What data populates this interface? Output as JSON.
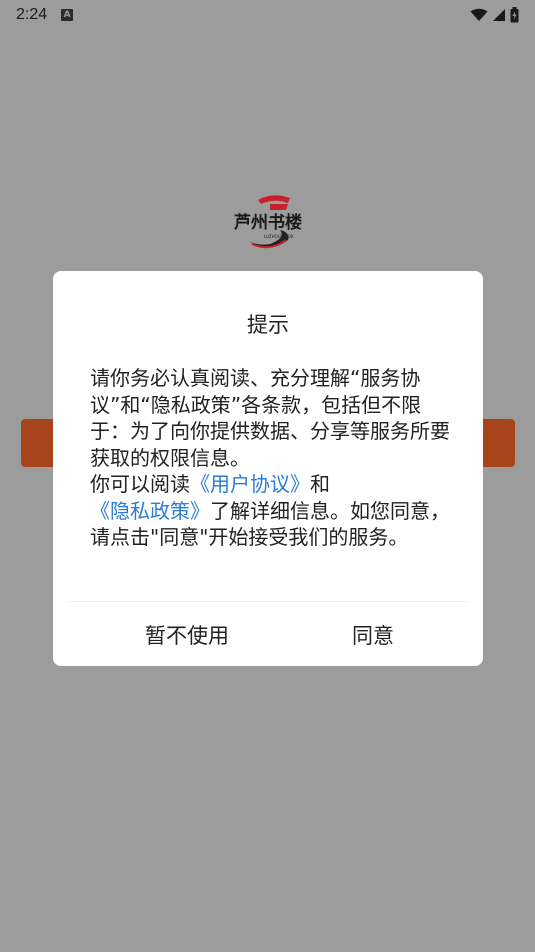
{
  "status_bar": {
    "time": "2:24",
    "app_icon_letter": "A",
    "icons": [
      "wifi-icon",
      "signal-icon",
      "battery-icon"
    ]
  },
  "logo": {
    "text": "芦州书楼",
    "subtext": "LUZHOU BOOK"
  },
  "dialog": {
    "title": "提示",
    "body_intro": "请你务必认真阅读、充分理解“服务协议”和“隐私政策”各条款，包括但不限于：为了向你提供数据、分享等服务所要获取的权限信息。",
    "read_prefix": "你可以阅读",
    "user_agreement_link": "《用户协议》",
    "and_text": "和",
    "privacy_policy_link": "《隐私政策》",
    "body_outro": "了解详细信息。如您同意，请点击\"同意\"开始接受我们的服务。",
    "decline_label": "暂不使用",
    "agree_label": "同意"
  },
  "colors": {
    "overlay": "#9c9c9c",
    "accent_button": "#a8441b",
    "link": "#2a7dd6",
    "logo_red": "#c8202a"
  }
}
